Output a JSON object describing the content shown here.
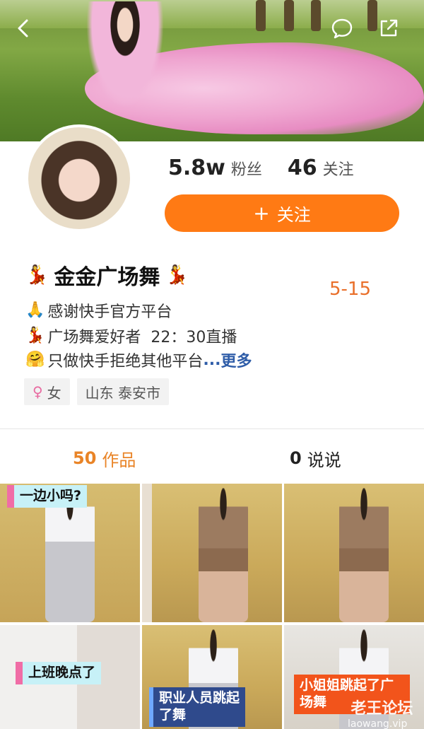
{
  "header": {
    "back_icon": "chevron-left-icon",
    "comment_icon": "speech-bubble-icon",
    "share_icon": "share-out-icon"
  },
  "profile": {
    "followers_count": "5.8w",
    "followers_label": "粉丝",
    "following_count": "46",
    "following_label": "关注",
    "follow_button_plus": "+",
    "follow_button_label": "关注",
    "name_emoji": "💃",
    "name": "金金广场舞",
    "date_tag": "5-15",
    "bio": [
      {
        "emoji": "🙏",
        "text": "感谢快手官方平台"
      },
      {
        "emoji": "💃",
        "text": "广场舞爱好者  22：30直播"
      },
      {
        "emoji": "🤗",
        "text": "只做快手拒绝其他平台",
        "ellipsis": "...",
        "more": "更多"
      }
    ],
    "tags": [
      {
        "icon": "female-icon",
        "glyph": "♀",
        "label": "女"
      },
      {
        "label": "山东 泰安市"
      }
    ]
  },
  "tabs": [
    {
      "count": "50",
      "label": "作品",
      "active": true
    },
    {
      "count": "0",
      "label": "说说",
      "active": false
    }
  ],
  "works": [
    {
      "caption": "一边小吗?"
    },
    {
      "caption": ""
    },
    {
      "caption": ""
    },
    {
      "caption": "上班晚点了"
    },
    {
      "caption": "职业人员跳起了舞"
    },
    {
      "caption": "小姐姐跳起了广场舞"
    }
  ],
  "watermark": {
    "title": "老王论坛",
    "url": "laowang.vip"
  },
  "colors": {
    "accent": "#ff7a14",
    "active_tab": "#e98427",
    "date_tag": "#e96f2a",
    "link": "#2f5da8"
  }
}
